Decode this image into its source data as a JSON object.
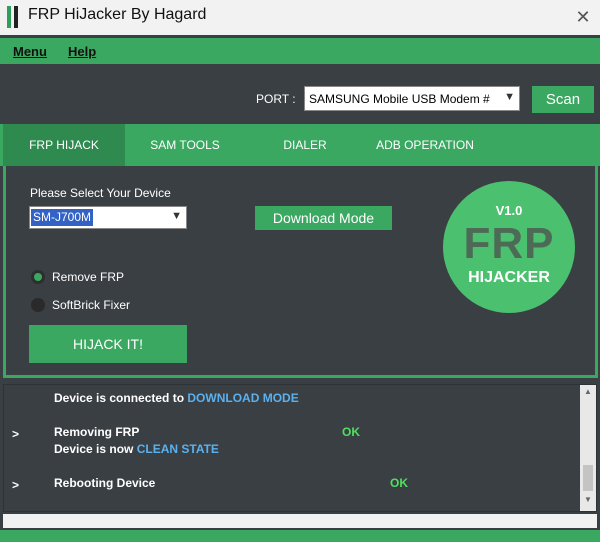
{
  "window": {
    "title": "FRP HiJacker By Hagard",
    "close_glyph": "✕"
  },
  "menu": {
    "items": [
      "Menu",
      "Help"
    ]
  },
  "port": {
    "label": "PORT :",
    "value": "SAMSUNG Mobile USB Modem #",
    "scan_label": "Scan"
  },
  "tabs": [
    "FRP HIJACK",
    "SAM TOOLS",
    "DIALER",
    "ADB OPERATION"
  ],
  "device": {
    "label": "Please Select Your Device",
    "value": "SM-J700M"
  },
  "download_label": "Download Mode",
  "options": {
    "remove_frp": {
      "label": "Remove FRP",
      "selected": true
    },
    "softbrick": {
      "label": "SoftBrick Fixer",
      "selected": false
    }
  },
  "hijack_label": "HIJACK IT!",
  "logo": {
    "version": "V1.0",
    "main": "FRP",
    "sub": "HIJACKER"
  },
  "log": {
    "l1_text": "Device is connected to ",
    "l1_hl": "DOWNLOAD MODE",
    "l2_arrow": ">",
    "l2_text": "Removing FRP",
    "l2_ok": "OK",
    "l3_text": "Device is now ",
    "l3_hl": "CLEAN STATE",
    "l4_arrow": ">",
    "l4_text": "Rebooting Device",
    "l4_ok": "OK"
  },
  "colors": {
    "accent": "#3ba862",
    "background": "#3a3f44",
    "highlight_text": "#5bb1ee",
    "ok_text": "#4ee05f"
  },
  "icons": {
    "close": "close-icon",
    "dropdown": "chevron-down-icon"
  }
}
